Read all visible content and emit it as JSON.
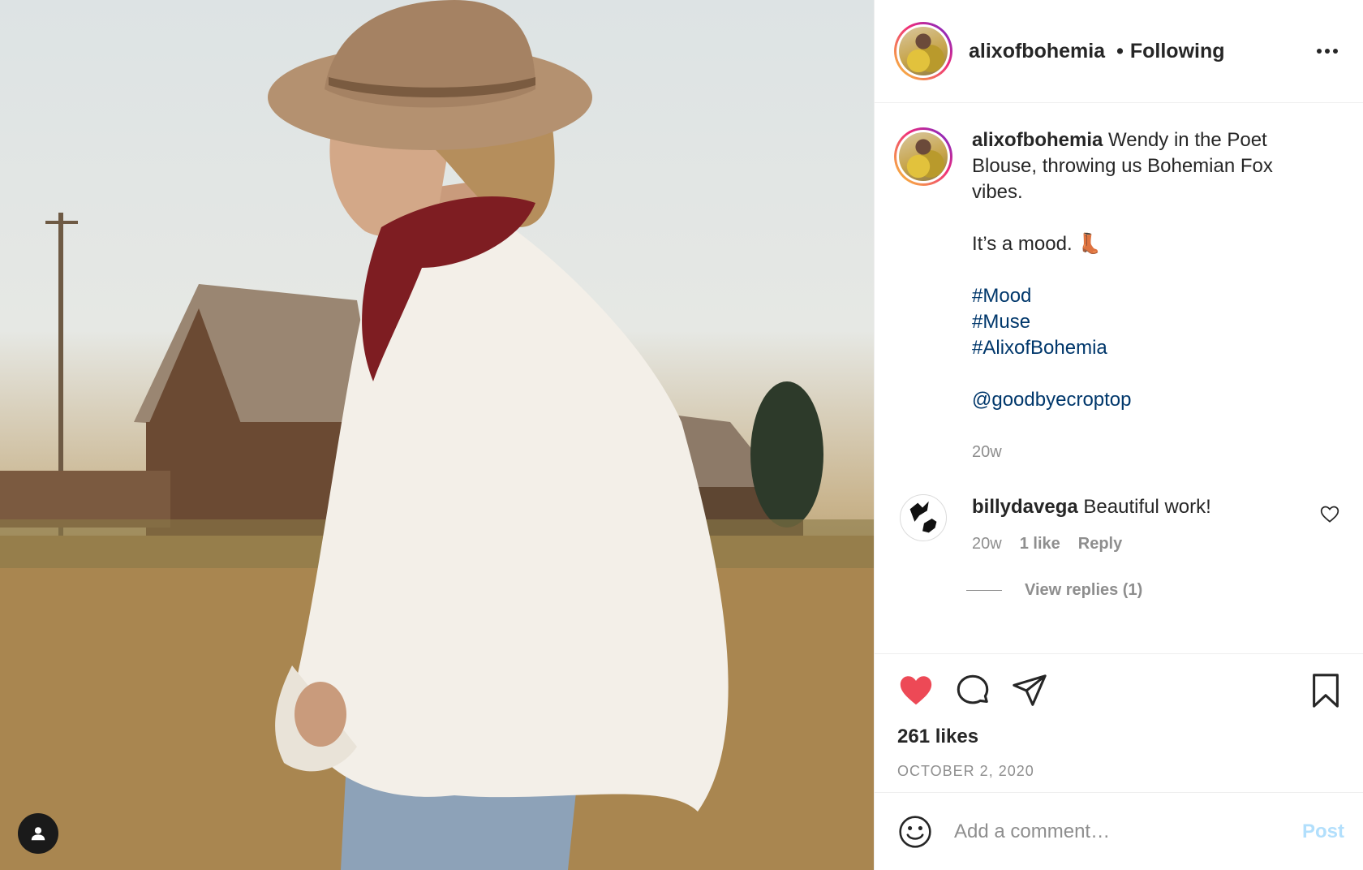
{
  "post": {
    "author": "alixofbohemia",
    "follow_status": "Following",
    "separator": "•",
    "caption": {
      "line1": "Wendy in the Poet Blouse, throwing us Bohemian Fox vibes.",
      "line2": "It’s a mood. 👢",
      "hashtags": [
        "#Mood",
        "#Muse",
        "#AlixofBohemia"
      ],
      "mention": "@goodbyecroptop",
      "time": "20w"
    },
    "comments": [
      {
        "user": "billydavega",
        "text": "Beautiful work!",
        "time": "20w",
        "likes": "1 like",
        "reply_label": "Reply",
        "view_replies": "View replies (1)"
      }
    ],
    "likes": "261 likes",
    "date": "OCTOBER 2, 2020",
    "liked": true
  },
  "composer": {
    "placeholder": "Add a comment…",
    "post_label": "Post"
  },
  "colors": {
    "like_red": "#ed4956",
    "link_blue": "#00376b",
    "muted": "#8e8e8e",
    "post_disabled": "#b2dffc"
  },
  "icons": [
    "user-tag-icon",
    "more-icon",
    "heart-icon",
    "comment-icon",
    "share-icon",
    "bookmark-icon",
    "emoji-icon",
    "comment-heart-icon"
  ]
}
